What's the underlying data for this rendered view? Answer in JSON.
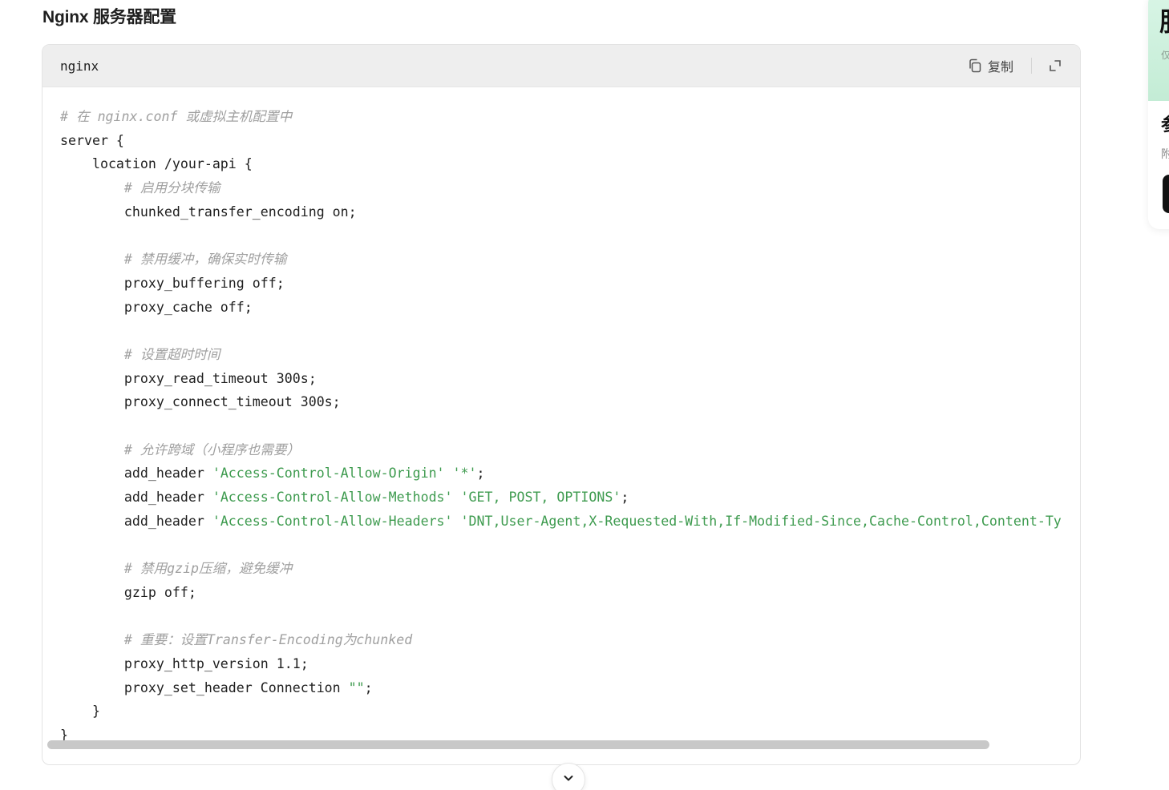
{
  "section": {
    "title": "Nginx 服务器配置"
  },
  "code_block": {
    "language": "nginx",
    "copy_label": "复制",
    "lines": [
      [
        {
          "t": "c",
          "v": "# 在 nginx.conf 或虚拟主机配置中"
        }
      ],
      [
        {
          "t": "p",
          "v": "server {"
        }
      ],
      [
        {
          "t": "p",
          "v": "    location /your-api {"
        }
      ],
      [
        {
          "t": "c",
          "v": "        # 启用分块传输"
        }
      ],
      [
        {
          "t": "p",
          "v": "        chunked_transfer_encoding on;"
        }
      ],
      [],
      [
        {
          "t": "c",
          "v": "        # 禁用缓冲，确保实时传输"
        }
      ],
      [
        {
          "t": "p",
          "v": "        proxy_buffering off;"
        }
      ],
      [
        {
          "t": "p",
          "v": "        proxy_cache off;"
        }
      ],
      [],
      [
        {
          "t": "c",
          "v": "        # 设置超时时间"
        }
      ],
      [
        {
          "t": "p",
          "v": "        proxy_read_timeout 300s;"
        }
      ],
      [
        {
          "t": "p",
          "v": "        proxy_connect_timeout 300s;"
        }
      ],
      [],
      [
        {
          "t": "c",
          "v": "        # 允许跨域（小程序也需要）"
        }
      ],
      [
        {
          "t": "p",
          "v": "        add_header "
        },
        {
          "t": "s",
          "v": "'Access-Control-Allow-Origin' '*'"
        },
        {
          "t": "p",
          "v": ";"
        }
      ],
      [
        {
          "t": "p",
          "v": "        add_header "
        },
        {
          "t": "s",
          "v": "'Access-Control-Allow-Methods' 'GET, POST, OPTIONS'"
        },
        {
          "t": "p",
          "v": ";"
        }
      ],
      [
        {
          "t": "p",
          "v": "        add_header "
        },
        {
          "t": "s",
          "v": "'Access-Control-Allow-Headers' 'DNT,User-Agent,X-Requested-With,If-Modified-Since,Cache-Control,Content-Ty"
        }
      ],
      [],
      [
        {
          "t": "c",
          "v": "        # 禁用gzip压缩，避免缓冲"
        }
      ],
      [
        {
          "t": "p",
          "v": "        gzip off;"
        }
      ],
      [],
      [
        {
          "t": "c",
          "v": "        # 重要：设置Transfer-Encoding为chunked"
        }
      ],
      [
        {
          "t": "p",
          "v": "        proxy_http_version 1.1;"
        }
      ],
      [
        {
          "t": "p",
          "v": "        proxy_set_header Connection "
        },
        {
          "t": "s",
          "v": "\"\""
        },
        {
          "t": "p",
          "v": ";"
        }
      ],
      [
        {
          "t": "p",
          "v": "    }"
        }
      ],
      [
        {
          "t": "p",
          "v": "}"
        }
      ]
    ]
  },
  "icons": {
    "copy": "copy-icon",
    "expand": "expand-icon",
    "scroll_down": "chevron-down-icon"
  },
  "colors": {
    "header_bg": "#eeeeee",
    "comment": "#a0a0a0",
    "string": "#3e9b4f",
    "side_banner": "#d9f5e6"
  },
  "side_panel": {
    "glyph_top": "服",
    "small_top": "仅",
    "glyph_mid": "参",
    "small_mid": "附"
  }
}
